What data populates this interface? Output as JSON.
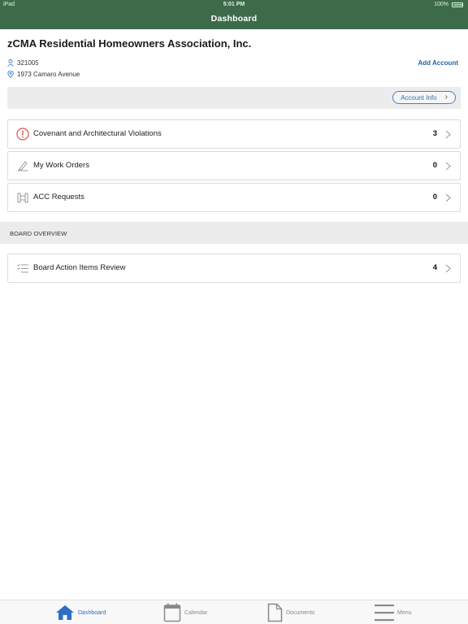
{
  "status_bar": {
    "carrier": "iPad",
    "time": "5:01 PM",
    "battery": "100%",
    "battery_level": 0.9
  },
  "header": {
    "title": "Dashboard"
  },
  "association": {
    "name": "zCMA Residential Homeowners Association, Inc.",
    "account_number": "321005",
    "address": "1973 Camaro Avenue",
    "add_account_label": "Add Account",
    "account_info_label": "Account Info"
  },
  "cards": [
    {
      "label": "Covenant and Architectural Violations",
      "count": "3",
      "icon": "violation-icon"
    },
    {
      "label": "My Work Orders",
      "count": "0",
      "icon": "work-order-icon"
    },
    {
      "label": "ACC Requests",
      "count": "0",
      "icon": "acc-request-icon"
    }
  ],
  "board": {
    "section_title": "BOARD OVERVIEW",
    "items": [
      {
        "label": "Board Action Items Review",
        "count": "4",
        "icon": "checklist-icon"
      }
    ]
  },
  "tabbar": {
    "tabs": [
      {
        "label": "Dashboard",
        "icon": "home-icon",
        "active": true
      },
      {
        "label": "Calendar",
        "icon": "calendar-icon",
        "active": false
      },
      {
        "label": "Documents",
        "icon": "document-icon",
        "active": false
      },
      {
        "label": "Menu",
        "icon": "menu-icon",
        "active": false
      }
    ]
  },
  "colors": {
    "header_bg": "#3d6b4a",
    "link": "#1e62a8",
    "violation": "#d9534f",
    "active_tab": "#2f6ec1"
  }
}
